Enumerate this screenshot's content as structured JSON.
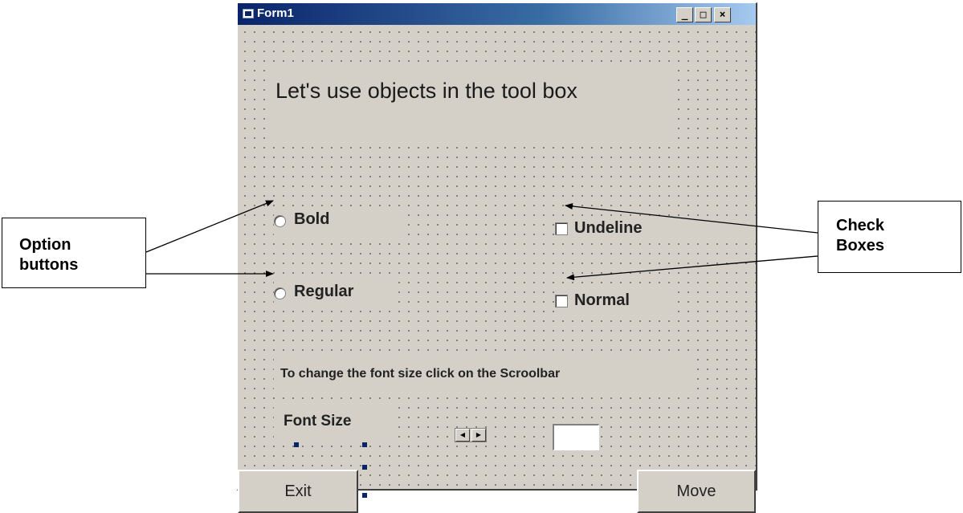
{
  "window": {
    "title": "Form1",
    "controls": {
      "minimize": "_",
      "maximize": "□",
      "close": "×"
    }
  },
  "form": {
    "heading": "Let's use objects in the tool box",
    "options": [
      {
        "label": "Bold",
        "selected": false
      },
      {
        "label": "Regular",
        "selected": false
      }
    ],
    "checkboxes": [
      {
        "label": "Undeline",
        "checked": false
      },
      {
        "label": "Normal",
        "checked": false
      }
    ],
    "scroll_instruction": "To change the font size click on the Scroolbar",
    "font_size_label": "Font Size",
    "font_size_value": "",
    "buttons": {
      "exit": "Exit",
      "move": "Move"
    }
  },
  "callouts": {
    "option_buttons": {
      "line1": "Option",
      "line2": "buttons"
    },
    "check_boxes": {
      "line1": "Check",
      "line2": "Boxes"
    }
  },
  "colors": {
    "titlebar_start": "#0a246a",
    "titlebar_end": "#a6caf0",
    "form_background": "#d4d0c8",
    "selection_handle": "#0a246a"
  },
  "icons": {
    "title_icon": "form-app-icon",
    "scroll_left": "scroll-left-arrow-icon",
    "scroll_right": "scroll-right-arrow-icon"
  }
}
